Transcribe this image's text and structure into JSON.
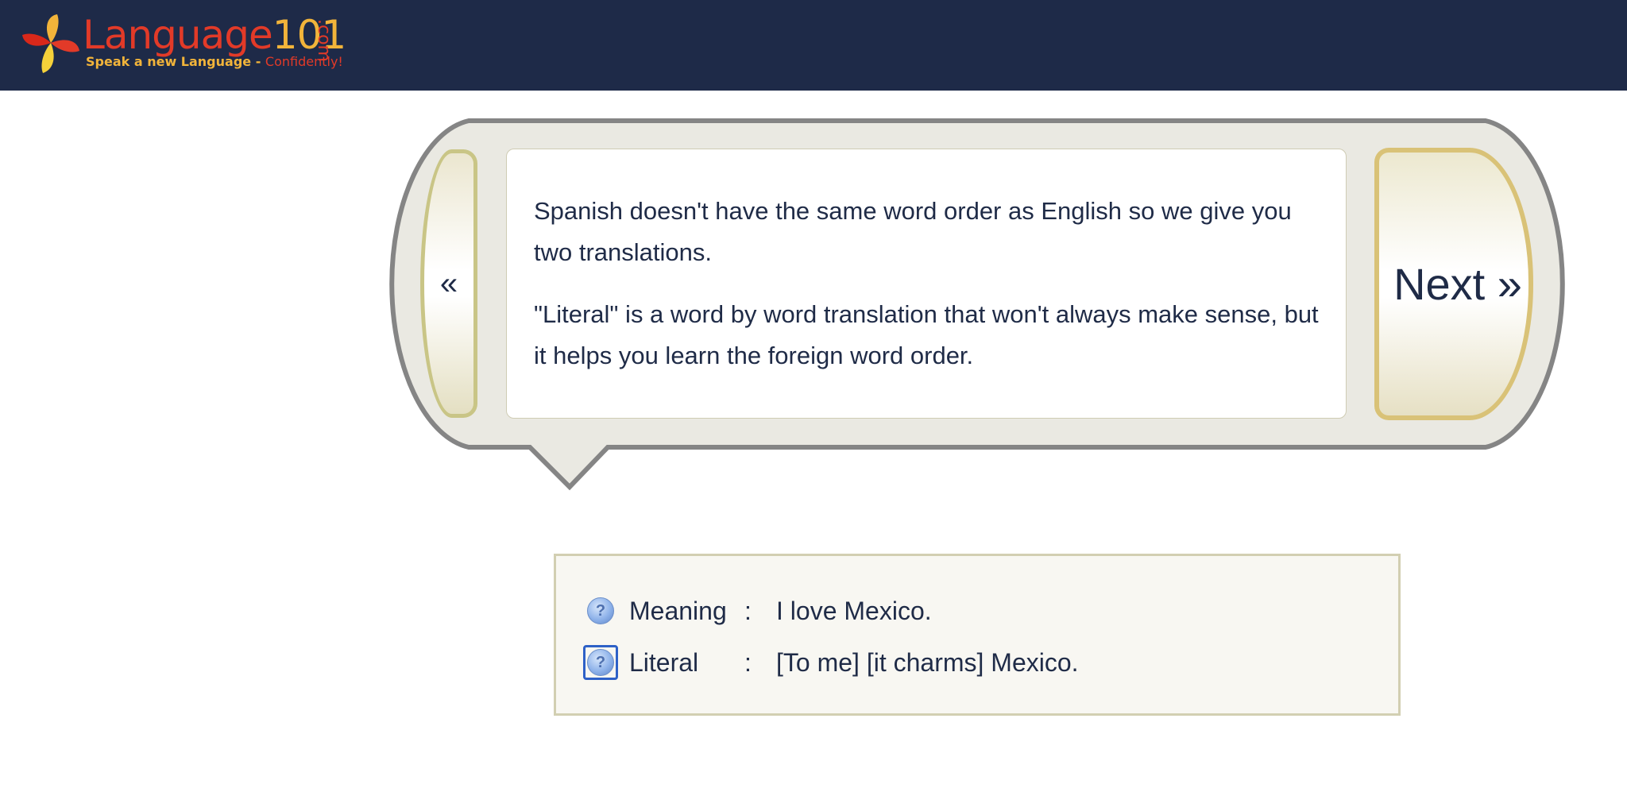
{
  "header": {
    "logo": {
      "word_main": "Language",
      "word_num": "101",
      "tld": ".com",
      "tagline_main": "Speak a new Language - ",
      "tagline_accent": "Confidently!"
    },
    "background": "#1e2a48"
  },
  "bubble": {
    "prev_label": "«",
    "next_label": "Next »",
    "paragraphs": [
      "Spanish doesn't have the same word order as English so we give you two translations.",
      "\"Literal\" is a word by word translation that won't always make sense, but it helps you learn the foreign word order."
    ]
  },
  "translation": {
    "rows": [
      {
        "icon": "help-icon",
        "label": "Meaning",
        "separator": ":",
        "value": "I love Mexico."
      },
      {
        "icon": "help-icon",
        "label": "Literal",
        "separator": ":",
        "value": "[To me] [it charms] Mexico."
      }
    ]
  },
  "colors": {
    "text": "#1f2b47",
    "logo_red": "#e23a28",
    "logo_gold": "#f2b43a",
    "focus_outline": "#2e61c7"
  }
}
